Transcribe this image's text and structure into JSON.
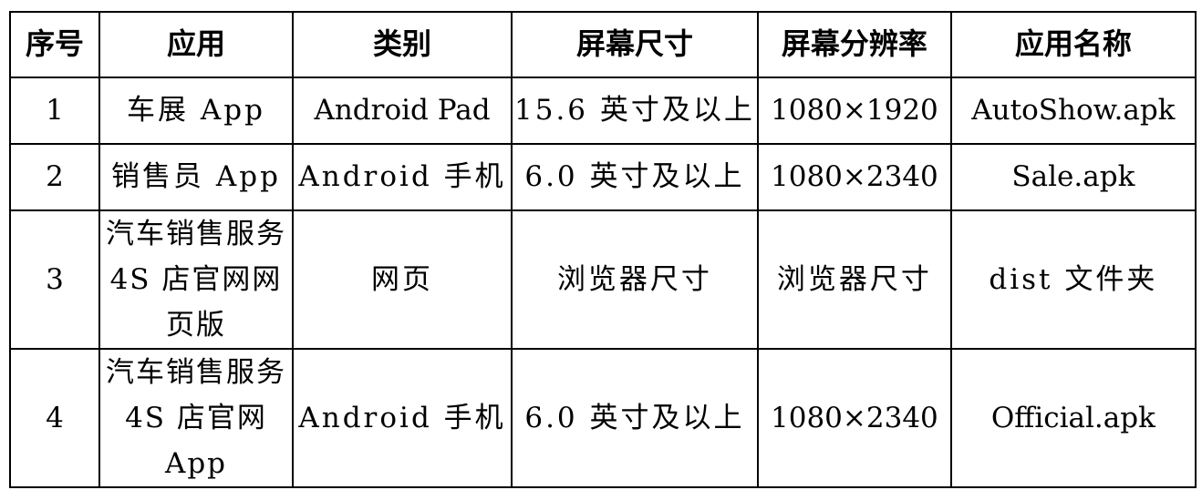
{
  "headers": [
    "序号",
    "应用",
    "类别",
    "屏幕尺寸",
    "屏幕分辨率",
    "应用名称"
  ],
  "rows": [
    [
      "1",
      "车展 App",
      "Android Pad",
      "15.6 英寸及以上",
      "1080×1920",
      "AutoShow.apk"
    ],
    [
      "2",
      "销售员 App",
      "Android 手机",
      "6.0 英寸及以上",
      "1080×2340",
      "Sale.apk"
    ],
    [
      "3",
      "汽车销售服务 4S 店官网网页版",
      "网页",
      "浏览器尺寸",
      "浏览器尺寸",
      "dist 文件夹"
    ],
    [
      "4",
      "汽车销售服务 4S 店官网 App",
      "Android 手机",
      "6.0 英寸及以上",
      "1080×2340",
      "Official.apk"
    ]
  ]
}
